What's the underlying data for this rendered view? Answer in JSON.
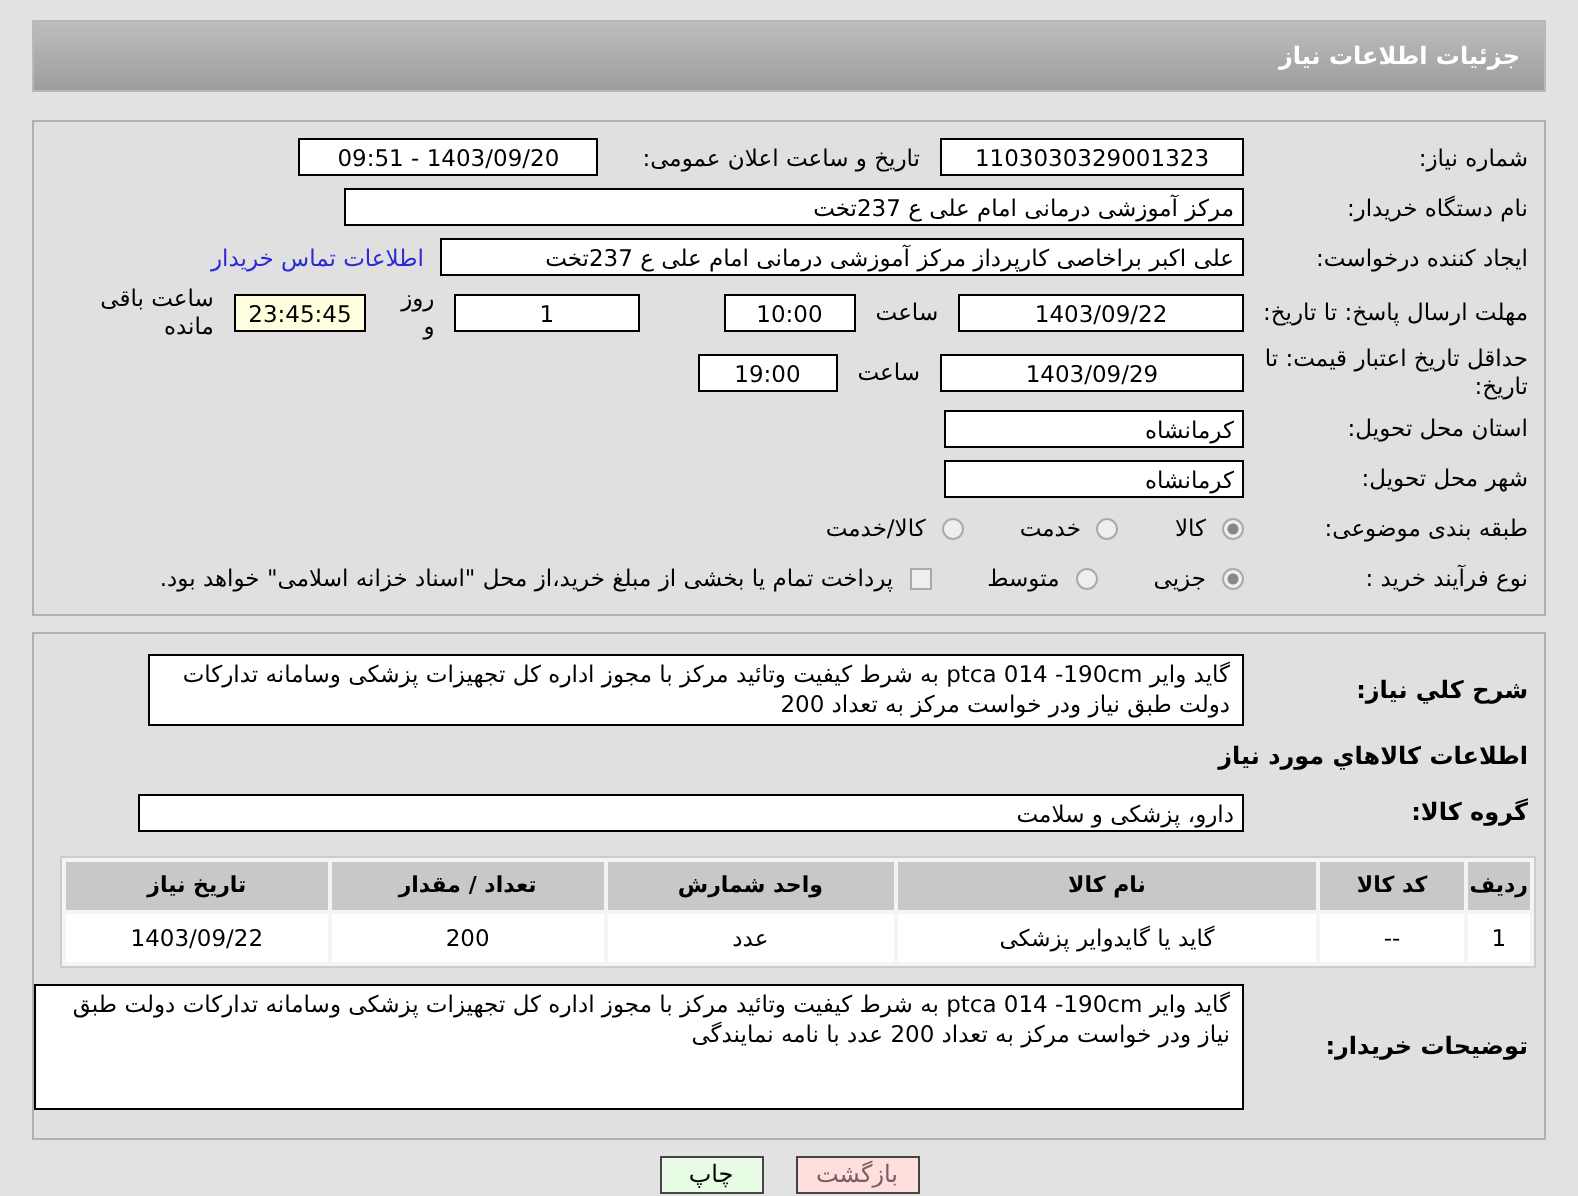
{
  "header": {
    "title": "جزئیات اطلاعات نیاز"
  },
  "form": {
    "need_number": {
      "label": "شماره نیاز:",
      "value": "1103030329001323"
    },
    "announce": {
      "label": "تاریخ و ساعت اعلان عمومی:",
      "value": "1403/09/20 - 09:51"
    },
    "buyer_org": {
      "label": "نام دستگاه خریدار:",
      "value": "مرکز آموزشی درمانی امام علی ع 237تخت"
    },
    "requester": {
      "label": "ایجاد کننده درخواست:",
      "value": "علی اکبر براخاصی کارپرداز  مرکز آموزشی درمانی امام علی ع 237تخت",
      "link": "اطلاعات تماس خریدار"
    },
    "deadline": {
      "label": "مهلت ارسال پاسخ: تا تاریخ:",
      "date": "1403/09/22",
      "time_label": "ساعت",
      "time": "10:00",
      "days": "1",
      "days_label": "روز و",
      "remaining": "23:45:45",
      "remaining_label": "ساعت باقی مانده"
    },
    "validity": {
      "label": "حداقل تاریخ اعتبار قیمت: تا تاریخ:",
      "date": "1403/09/29",
      "time_label": "ساعت",
      "time": "19:00"
    },
    "province": {
      "label": "استان محل تحویل:",
      "value": "کرمانشاه"
    },
    "city": {
      "label": "شهر محل تحویل:",
      "value": "کرمانشاه"
    },
    "category": {
      "label": "طبقه بندی موضوعی:",
      "options": [
        {
          "label": "کالا",
          "selected": true
        },
        {
          "label": "خدمت",
          "selected": false
        },
        {
          "label": "کالا/خدمت",
          "selected": false
        }
      ]
    },
    "process": {
      "label": "نوع فرآیند خرید :",
      "options": [
        {
          "label": "جزیی",
          "selected": true
        },
        {
          "label": "متوسط",
          "selected": false
        }
      ],
      "payment": {
        "label": "پرداخت تمام یا بخشی از مبلغ خرید،از محل \"اسناد خزانه اسلامی\" خواهد بود.",
        "checked": false
      }
    }
  },
  "description": {
    "label": "شرح کلي نياز:",
    "value": "گاید وایر ptca 014 -190cm به شرط کیفیت وتائید مرکز با مجوز اداره کل تجهیزات پزشکی وسامانه تدارکات دولت طبق نیاز ودر خواست مرکز به تعداد 200"
  },
  "goods_heading": "اطلاعات کالاهاي مورد نياز",
  "goods_group": {
    "label": "گروه کالا:",
    "value": "دارو، پزشکی و سلامت"
  },
  "table": {
    "columns": [
      "ردیف",
      "کد کالا",
      "نام کالا",
      "واحد شمارش",
      "تعداد / مقدار",
      "تاریخ نیاز"
    ],
    "rows": [
      [
        "1",
        "--",
        "گاید یا گایدوایر پزشکی",
        "عدد",
        "200",
        "1403/09/22"
      ]
    ]
  },
  "buyer_notes": {
    "label": "توضیحات خریدار:",
    "value": "گاید وایر ptca 014 -190cm به شرط کیفیت وتائید مرکز با مجوز اداره کل تجهیزات پزشکی وسامانه تدارکات دولت طبق نیاز ودر خواست مرکز به تعداد 200 عدد با نامه نمایندگی"
  },
  "buttons": [
    {
      "label": "بازگشت",
      "kind": "back"
    },
    {
      "label": "چاپ",
      "kind": "print"
    }
  ]
}
